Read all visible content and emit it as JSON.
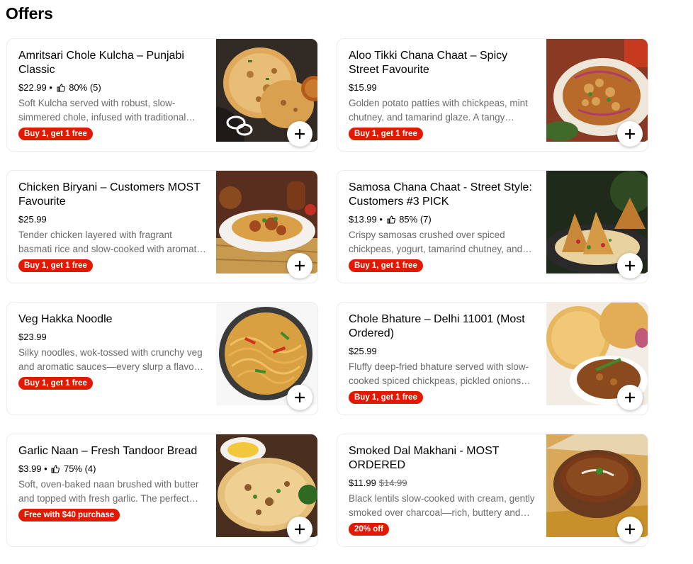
{
  "section": {
    "title": "Offers"
  },
  "items": [
    {
      "name": "Amritsari Chole Kulcha – Punjabi Classic",
      "price": "$22.99",
      "rating": "80% (5)",
      "description": "Soft Kulcha served with robust, slow-simmered chole, infused with traditional spices and tangy flavors.",
      "promo": "Buy 1, get 1 free",
      "image": "chole-kulcha-photo"
    },
    {
      "name": "Aloo Tikki Chana Chaat – Spicy Street Favourite",
      "price": "$15.99",
      "description": "Golden potato patties with chickpeas, mint chutney, and tamarind glaze. A tangy crunchy delight.",
      "promo": "Buy 1, get 1 free",
      "image": "aloo-tikki-chaat-photo"
    },
    {
      "name": "Chicken Biryani – Customers MOST Favourite",
      "price": "$25.99",
      "description": "Tender chicken layered with fragrant basmati rice and slow-cooked with aromatic spices.",
      "promo": "Buy 1, get 1 free",
      "image": "chicken-biryani-photo"
    },
    {
      "name": "Samosa Chana Chaat - Street Style: Customers #3 PICK",
      "price": "$13.99",
      "rating": "85% (7)",
      "description": "Crispy samosas crushed over spiced chickpeas, yogurt, tamarind chutney, and sev.",
      "promo": "Buy 1, get 1 free",
      "image": "samosa-chaat-photo"
    },
    {
      "name": "Veg Hakka Noodle",
      "price": "$23.99",
      "description": "Silky noodles, wok-tossed with crunchy veg and aromatic sauces—every slurp a flavor burst.",
      "promo": "Buy 1, get 1 free",
      "image": "hakka-noodle-photo"
    },
    {
      "name": "Chole Bhature – Delhi 11001 (Most Ordered)",
      "price": "$25.99",
      "description": "Fluffy deep-fried bhature served with slow-cooked spiced chickpeas, pickled onions and chutney.",
      "promo": "Buy 1, get 1 free",
      "image": "chole-bhature-photo"
    },
    {
      "name": "Garlic Naan – Fresh Tandoor Bread",
      "price": "$3.99",
      "rating": "75% (4)",
      "description": "Soft, oven-baked naan brushed with butter and topped with fresh garlic. The perfect side.",
      "promo": "Free with $40 purchase",
      "image": "garlic-naan-photo"
    },
    {
      "name": "Smoked Dal Makhani - MOST ORDERED",
      "price": "$11.99",
      "old_price": "$14.99",
      "description": "Black lentils slow-cooked with cream, gently smoked over charcoal—rich, buttery and comforting.",
      "promo": "20% off",
      "image": "dal-makhani-photo"
    }
  ],
  "colors": {
    "promo_badge": "#e11900",
    "description_text": "#6b6b6b",
    "card_border": "#ececec"
  },
  "icons": {
    "add": "plus-icon",
    "rating": "thumbs-up-icon"
  }
}
